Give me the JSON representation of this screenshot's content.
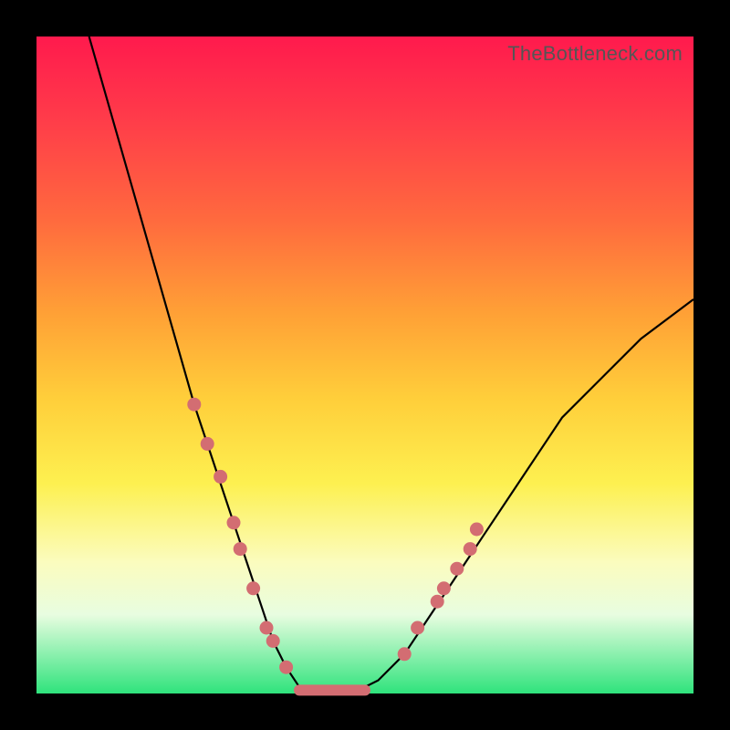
{
  "watermark": "TheBottleneck.com",
  "colors": {
    "marker": "#d36d72",
    "curve": "#000000",
    "gradient_top": "#ff1a4d",
    "gradient_bottom": "#2fe37c",
    "frame": "#000000"
  },
  "chart_data": {
    "type": "line",
    "title": "",
    "xlabel": "",
    "ylabel": "",
    "xlim": [
      0,
      100
    ],
    "ylim": [
      0,
      100
    ],
    "grid": false,
    "legend": false,
    "series": [
      {
        "name": "bottleneck-curve",
        "x": [
          8,
          12,
          16,
          20,
          24,
          26,
          28,
          30,
          32,
          34,
          36,
          38,
          40,
          42,
          44,
          48,
          52,
          56,
          60,
          64,
          68,
          72,
          76,
          80,
          86,
          92,
          100
        ],
        "y": [
          100,
          86,
          72,
          58,
          44,
          38,
          32,
          26,
          20,
          14,
          8,
          4,
          1,
          0,
          0,
          0,
          2,
          6,
          12,
          18,
          24,
          30,
          36,
          42,
          48,
          54,
          60
        ]
      }
    ],
    "markers": [
      {
        "x": 24,
        "y": 44
      },
      {
        "x": 26,
        "y": 38
      },
      {
        "x": 28,
        "y": 33
      },
      {
        "x": 30,
        "y": 26
      },
      {
        "x": 31,
        "y": 22
      },
      {
        "x": 33,
        "y": 16
      },
      {
        "x": 35,
        "y": 10
      },
      {
        "x": 36,
        "y": 8
      },
      {
        "x": 38,
        "y": 4
      },
      {
        "x": 56,
        "y": 6
      },
      {
        "x": 58,
        "y": 10
      },
      {
        "x": 61,
        "y": 14
      },
      {
        "x": 62,
        "y": 16
      },
      {
        "x": 64,
        "y": 19
      },
      {
        "x": 66,
        "y": 22
      },
      {
        "x": 67,
        "y": 25
      }
    ],
    "floor_segment": {
      "x_start": 40,
      "x_end": 50,
      "y": 0.5
    }
  }
}
